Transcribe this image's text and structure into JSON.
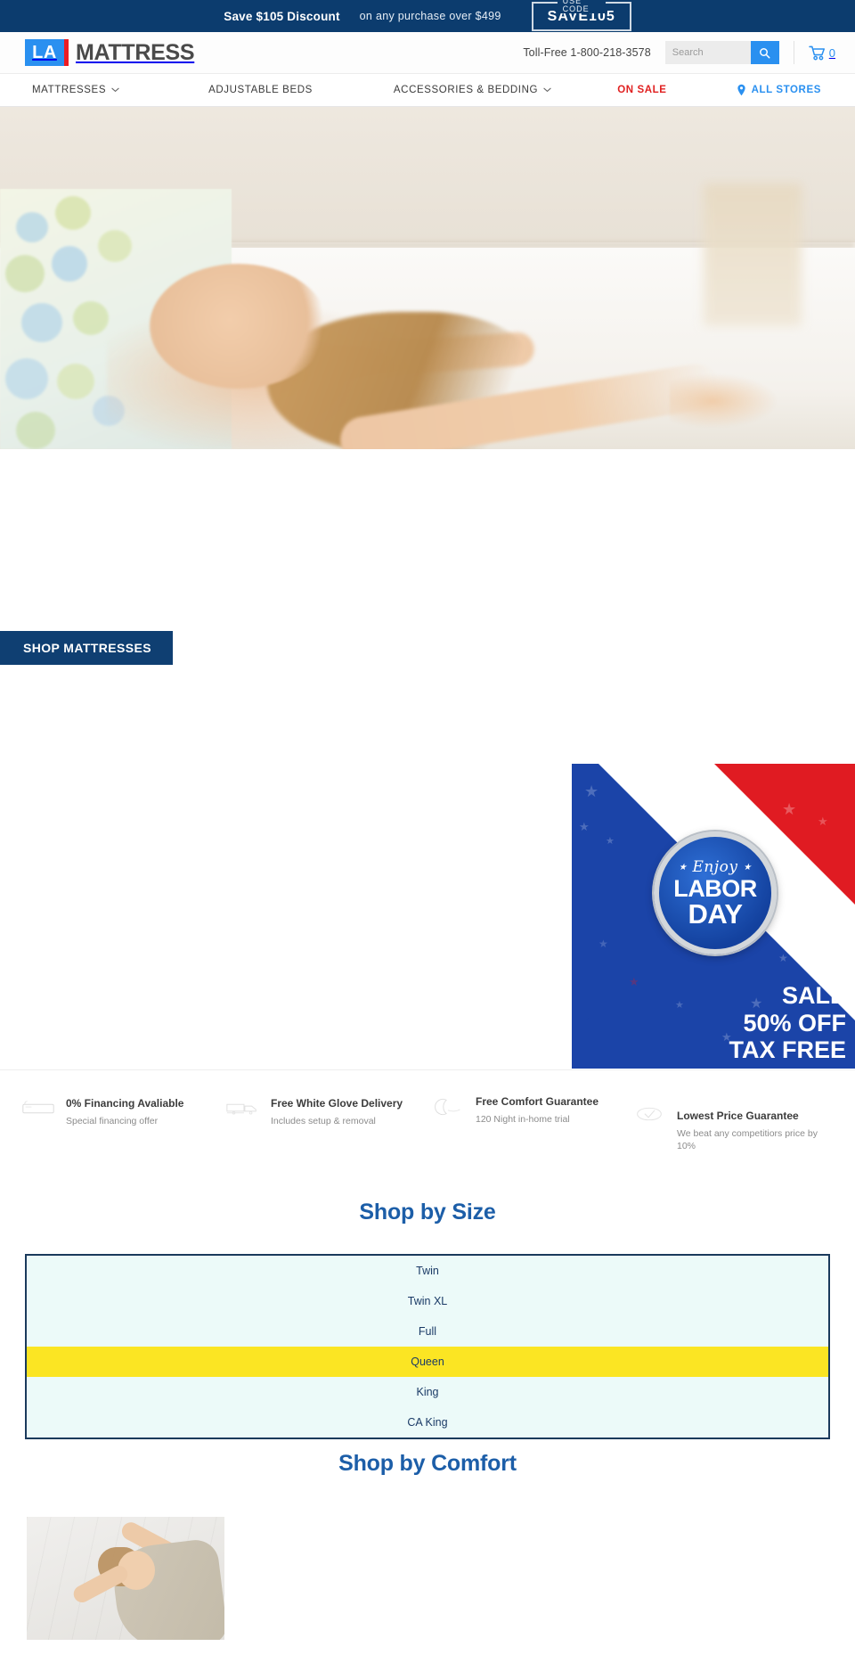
{
  "promo": {
    "headline": "Save $105 Discount",
    "subtext": "on any purchase over $499",
    "use_code_label": "USE CODE",
    "code": "SAVE105"
  },
  "header": {
    "logo_mark": "LA",
    "logo_text": "MATTRESS",
    "phone": "Toll-Free 1-800-218-3578",
    "search_placeholder": "Search",
    "search_value": "",
    "search_icon": "search-icon",
    "cart_icon": "cart-icon",
    "cart_count": "0"
  },
  "nav": {
    "items": [
      {
        "label": "MATTRESSES",
        "has_caret": true
      },
      {
        "label": "ADJUSTABLE BEDS",
        "has_caret": false
      },
      {
        "label": "ACCESSORIES & BEDDING",
        "has_caret": true
      },
      {
        "label": "ON SALE",
        "has_caret": false
      },
      {
        "label": "ALL STORES",
        "has_caret": false
      }
    ],
    "on_sale_color": "#e02020",
    "all_stores_color": "#2a90f0",
    "pin_icon": "location-pin-icon"
  },
  "hero": {
    "alt": "Smiling woman stretching on bed with polka dot bedding"
  },
  "cta": {
    "shop_button": "SHOP MATTRESSES"
  },
  "labor_banner": {
    "badge_enjoy": "Enjoy",
    "badge_labor": "LABOR",
    "badge_day": "DAY",
    "line1": "SALE",
    "line2": "50% OFF",
    "line3": "TAX FREE",
    "colors": {
      "blue": "#1b44a8",
      "red": "#e01b22",
      "white": "#ffffff"
    }
  },
  "features": [
    {
      "icon": "credit-card-icon",
      "title": "0% Financing Avaliable",
      "subtitle": "Special financing offer"
    },
    {
      "icon": "delivery-truck-icon",
      "title": "Free White Glove Delivery",
      "subtitle": "Includes setup & removal"
    },
    {
      "icon": "moon-icon",
      "title": "Free Comfort Guarantee",
      "subtitle": "120 Night in-home trial"
    },
    {
      "icon": "price-tag-icon",
      "title": "Lowest Price Guarantee",
      "subtitle": "We beat any competitiors price by 10%"
    }
  ],
  "shop_by_size": {
    "title": "Shop by Size",
    "items": [
      {
        "label": "Twin",
        "selected": false
      },
      {
        "label": "Twin XL",
        "selected": false
      },
      {
        "label": "Full",
        "selected": false
      },
      {
        "label": "Queen",
        "selected": true
      },
      {
        "label": "King",
        "selected": false
      },
      {
        "label": "CA King",
        "selected": false
      }
    ],
    "selected_color": "#fbe523",
    "background_color": "#ecfaf9",
    "border_color": "#1a3a5c"
  },
  "shop_by_comfort": {
    "title": "Shop by Comfort",
    "image_alt": "Woman lying on light wood floor"
  }
}
